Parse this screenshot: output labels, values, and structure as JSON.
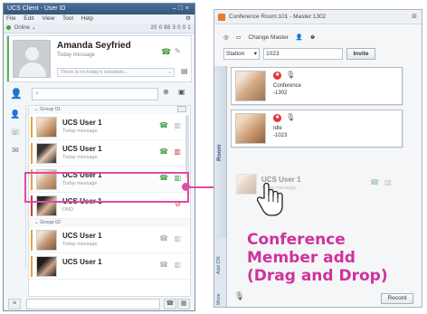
{
  "client": {
    "title": "UCS Client - User ID",
    "menu": [
      "File",
      "Edit",
      "View",
      "Tool",
      "Help"
    ],
    "status": "Online",
    "counts": "20 0  88 3  0 0  1",
    "profile": {
      "name": "Amanda Seyfried",
      "message": "Today message",
      "schedule_placeholder": "There is no today's schedule..."
    },
    "groups": [
      {
        "label": "Group 01",
        "contacts": [
          {
            "name": "UCS User 1",
            "message": "Today message"
          },
          {
            "name": "UCS User 1",
            "message": "Today message"
          },
          {
            "name": "UCS User 1",
            "message": "Today message"
          },
          {
            "name": "UCS User 1",
            "message": "DND"
          }
        ]
      },
      {
        "label": "Group 02",
        "contacts": [
          {
            "name": "UCS User 1",
            "message": "Today message"
          },
          {
            "name": "UCS User 1",
            "message": ""
          }
        ]
      }
    ]
  },
  "conference": {
    "title": "Conference Room:101 - Master:1302",
    "change_master": "Change Master",
    "select_value": "Station",
    "number_value": "1023",
    "invite_label": "Invite",
    "room_tab": "Room",
    "add_tab": "Add ON",
    "more_tab": "More",
    "members": [
      {
        "state": "Conference",
        "number": "-1302"
      },
      {
        "state": "Idle",
        "number": "-1023"
      }
    ],
    "dragged": {
      "name": "UCS User 1",
      "message": "Today message"
    },
    "record_label": "Record"
  },
  "caption": [
    "Conference",
    "Member add",
    "(Drag and Drop)"
  ],
  "colors": {
    "accent": "#e04aa6",
    "caption": "#d0329b",
    "online": "#3fa33a"
  }
}
